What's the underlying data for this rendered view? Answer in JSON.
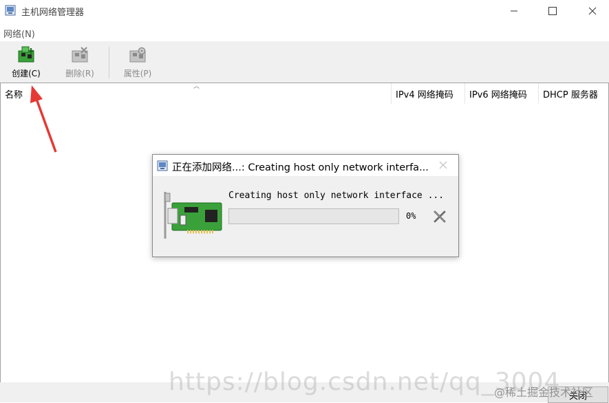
{
  "window": {
    "title": "主机网络管理器"
  },
  "menu": {
    "network": "网络(N)"
  },
  "toolbar": {
    "create_label": "创建(C)",
    "delete_label": "删除(R)",
    "properties_label": "属性(P)"
  },
  "table": {
    "columns": [
      "名称",
      "IPv4 网络掩码",
      "IPv6 网络掩码",
      "DHCP 服务器"
    ],
    "rows": []
  },
  "footer": {
    "close_label": "关闭"
  },
  "dialog": {
    "title": "正在添加网络...: Creating host only network interfa...",
    "message": "Creating host only network interface ...",
    "progress_text": "0%",
    "progress_value": 0
  },
  "watermark": {
    "url": "https://blog.csdn.net/qq_3004",
    "community": "@稀土掘金技术社区"
  },
  "colors": {
    "nic_board": "#3aa13a",
    "annotation_arrow": "#e53935",
    "toolbar_bg": "#f0f0f0"
  },
  "icons": {
    "app": "vbox-network-icon",
    "create": "network-add-icon",
    "delete": "network-remove-icon",
    "properties": "network-properties-icon",
    "nic": "network-card-icon",
    "cancel": "cancel-x-icon"
  }
}
